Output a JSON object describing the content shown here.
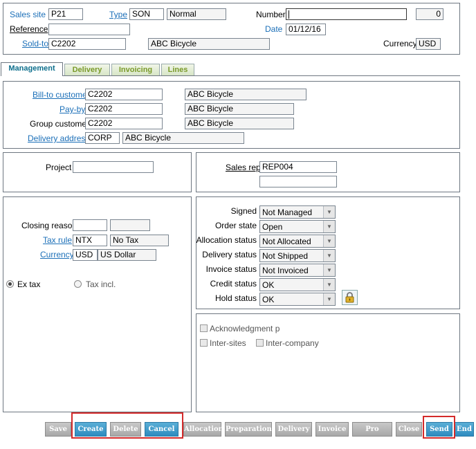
{
  "header": {
    "sales_site": {
      "label": "Sales site",
      "value": "P21"
    },
    "type": {
      "label": "Type",
      "code": "SON",
      "desc": "Normal"
    },
    "number": {
      "label": "Number",
      "value": "",
      "count": "0"
    },
    "reference": {
      "label": "Reference",
      "value": ""
    },
    "date": {
      "label": "Date",
      "value": "01/12/16"
    },
    "sold_to": {
      "label": "Sold-to",
      "code": "C2202",
      "name": "ABC Bicycle"
    },
    "currency": {
      "label": "Currency",
      "value": "USD"
    }
  },
  "tabs": [
    {
      "label": "Management",
      "active": true
    },
    {
      "label": "Delivery",
      "active": false
    },
    {
      "label": "Invoicing",
      "active": false
    },
    {
      "label": "Lines",
      "active": false
    }
  ],
  "customers": {
    "bill_to": {
      "label": "Bill-to customer",
      "code": "C2202",
      "name": "ABC Bicycle"
    },
    "pay_by": {
      "label": "Pay-by",
      "code": "C2202",
      "name": "ABC Bicycle"
    },
    "group": {
      "label": "Group customer",
      "code": "C2202",
      "name": "ABC Bicycle"
    },
    "delivery_address": {
      "label": "Delivery address",
      "code": "CORP",
      "name": "ABC Bicycle"
    }
  },
  "project": {
    "label": "Project",
    "value": ""
  },
  "sales_rep": {
    "label": "Sales rep",
    "value": "REP004",
    "value2": ""
  },
  "tax": {
    "closing_reason": {
      "label": "Closing reason",
      "value1": "",
      "value2": ""
    },
    "tax_rule": {
      "label": "Tax rule",
      "code": "NTX",
      "desc": "No Tax"
    },
    "currency": {
      "label": "Currency",
      "code": "USD",
      "desc": "US Dollar"
    },
    "ex_tax": "Ex tax",
    "tax_incl": "Tax incl."
  },
  "status": {
    "signed": {
      "label": "Signed",
      "value": "Not Managed"
    },
    "order_state": {
      "label": "Order state",
      "value": "Open"
    },
    "allocation": {
      "label": "Allocation status",
      "value": "Not Allocated"
    },
    "delivery": {
      "label": "Delivery status",
      "value": "Not Shipped"
    },
    "invoice": {
      "label": "Invoice status",
      "value": "Not Invoiced"
    },
    "credit": {
      "label": "Credit status",
      "value": "OK"
    },
    "hold": {
      "label": "Hold status",
      "value": "OK"
    }
  },
  "options": {
    "acknowledgment": "Acknowledgment p",
    "inter_sites": "Inter-sites",
    "inter_company": "Inter-company"
  },
  "toolbar": {
    "save": "Save",
    "create": "Create",
    "delete": "Delete",
    "cancel": "Cancel",
    "allocation": "Allocation",
    "preparation": "Preparation",
    "delivery": "Delivery",
    "invoice": "Invoice",
    "pro_forma": "Pro forma",
    "close": "Close",
    "send": "Send",
    "end": "End"
  },
  "icons": {
    "lock": "lock-icon"
  }
}
